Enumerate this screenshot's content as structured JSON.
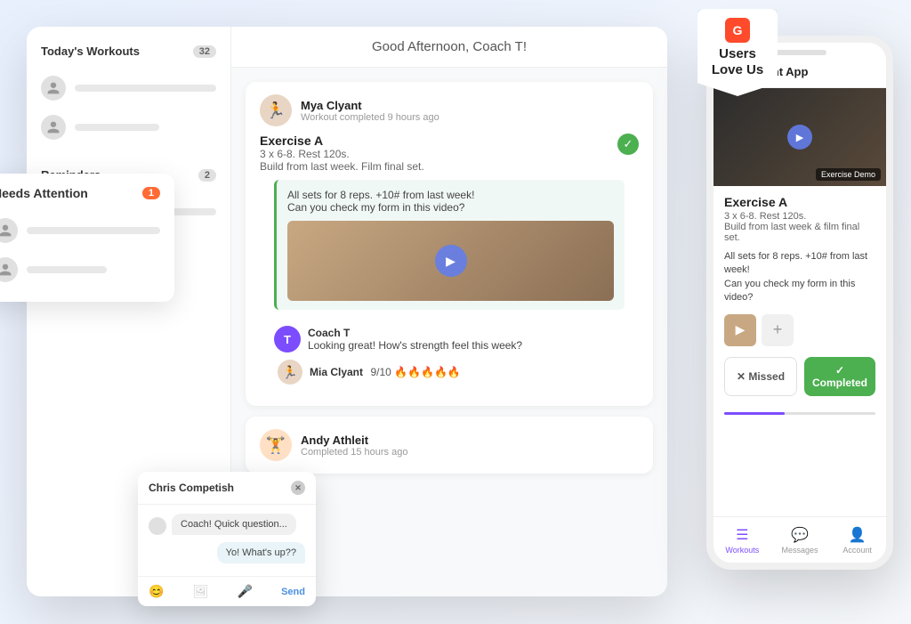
{
  "scene": {
    "background": "#f0f4f8"
  },
  "dashboard": {
    "header": "Good Afternoon, Coach T!",
    "sidebar": {
      "today_workouts": {
        "title": "Today's Workouts",
        "count": "32"
      },
      "needs_attention": {
        "title": "Needs Attention",
        "count": "1"
      },
      "reminders": {
        "title": "Reminders",
        "count": "2"
      }
    }
  },
  "feed": {
    "item1": {
      "user": "Mya Clyant",
      "time": "Workout completed 9 hours ago",
      "exercise_title": "Exercise A",
      "exercise_detail": "3 x 6-8. Rest 120s.",
      "exercise_note": "Build from last week. Film final set.",
      "comment": "All sets for 8 reps. +10# from last week!\nCan you check my form in this video?",
      "coach_name": "Coach T",
      "coach_msg": "Looking great! How's strength feel this week?",
      "client_reply_name": "Mia Clyant",
      "client_reply_msg": "9/10 🔥🔥🔥🔥🔥"
    },
    "item2": {
      "user": "Andy Athleit",
      "time": "Completed 15 hours ago"
    }
  },
  "chat_popup": {
    "title": "Chris Competish",
    "message1": "Coach! Quick question...",
    "message2": "Yo! What's up??"
  },
  "g2_badge": {
    "logo": "G",
    "line1": "Users",
    "line2": "Love Us"
  },
  "mobile_app": {
    "title": "Client App",
    "exercise_title": "Exercise A",
    "exercise_detail": "3 x 6-8. Rest 120s.",
    "exercise_note": "Build from last week & film final set.",
    "comment": "All sets for 8 reps. +10# from last week!\nCan you check my form in this video?",
    "demo_label": "Exercise Demo",
    "btn_missed": "✕  Missed",
    "btn_completed": "✓  Completed",
    "nav": {
      "workouts": "Workouts",
      "messages": "Messages",
      "account": "Account"
    }
  }
}
